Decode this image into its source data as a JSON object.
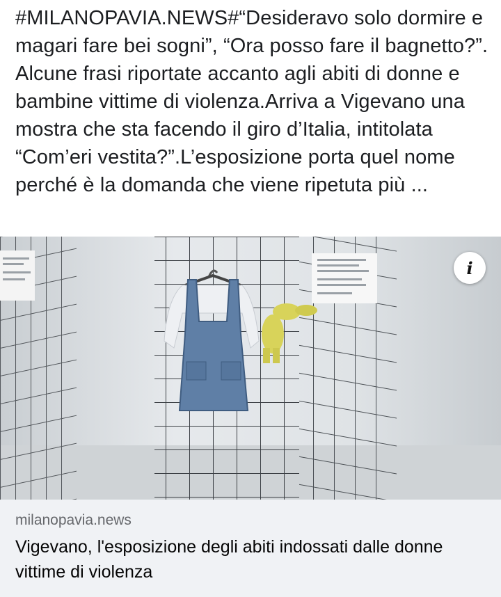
{
  "post": {
    "text": "#MILANOPAVIA.NEWS#“Desideravo solo dormire e magari fare bei sogni”, “Ora posso fare il bagnetto?”. Alcune frasi riportate accanto agli abiti di donne e bambine vittime di violenza.Arriva a Vigevano una mostra che sta facendo il giro d’Italia, intitolata “Com’eri vestita?”.L’esposizione porta quel nome perché è la domanda che viene ripetuta più ..."
  },
  "photo": {
    "info_icon": "i"
  },
  "link_preview": {
    "domain": "milanopavia.news",
    "title": "Vigevano, l'esposizione degli abiti indossati dalle donne vittime di violenza"
  }
}
